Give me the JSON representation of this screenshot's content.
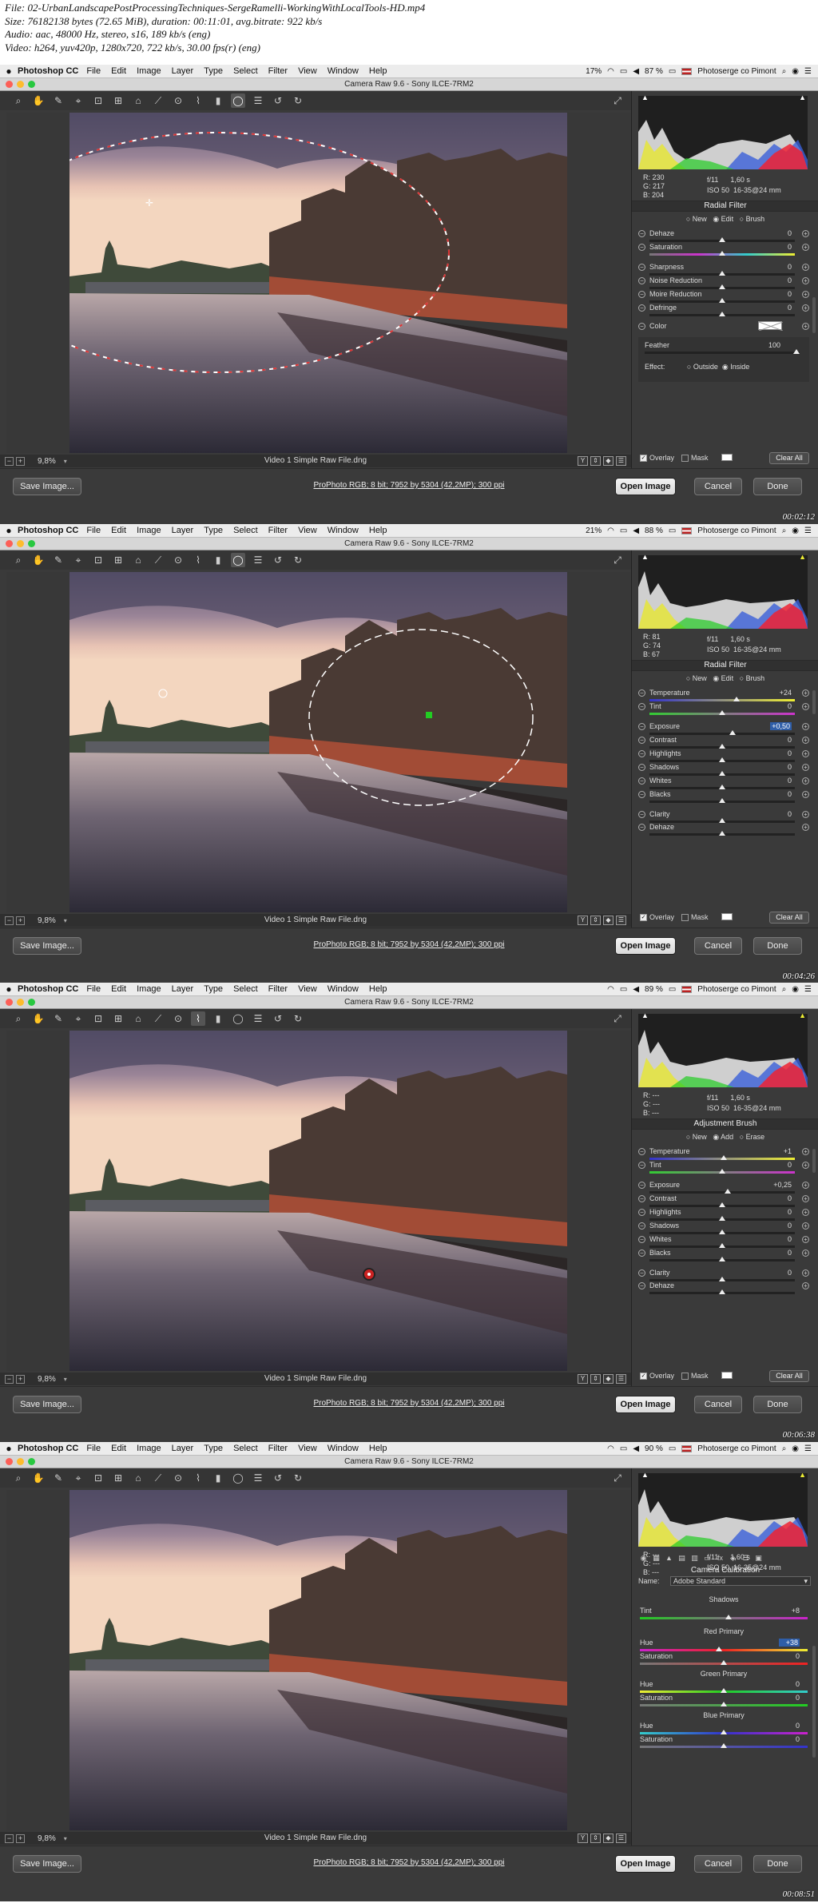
{
  "info_lines": [
    "File: 02-UrbanLandscapePostProcessingTechniques-SergeRamelli-WorkingWithLocalTools-HD.mp4",
    "Size: 76182138 bytes (72.65 MiB), duration: 00:11:01, avg.bitrate: 922 kb/s",
    "Audio: aac, 48000 Hz, stereo, s16, 189 kb/s (eng)",
    "Video: h264, yuv420p, 1280x720, 722 kb/s, 30.00 fps(r) (eng)"
  ],
  "menubar": {
    "app": "Photoshop CC",
    "items": [
      "File",
      "Edit",
      "Image",
      "Layer",
      "Type",
      "Select",
      "Filter",
      "View",
      "Window",
      "Help"
    ],
    "user": "Photoserge co Pimont"
  },
  "window_title": "Camera Raw 9.6  -  Sony ILCE-7RM2",
  "statusbar": {
    "zoom": "9,8%",
    "filename": "Video 1 Simple Raw File.dng"
  },
  "bottom": {
    "save": "Save Image...",
    "workflow": "ProPhoto RGB; 8 bit; 7952 by 5304 (42,2MP); 300 ppi",
    "open": "Open Image",
    "cancel": "Cancel",
    "done": "Done"
  },
  "camera_info": {
    "aperture": "f/11",
    "shutter": "1,60 s",
    "iso": "ISO 50",
    "lens": "16-35@24 mm"
  },
  "overlay": {
    "overlay": "Overlay",
    "mask": "Mask",
    "clear_all": "Clear All"
  },
  "frames": [
    {
      "menu_pct": "17%",
      "battery": "87 %",
      "timestamp": "00:02:12",
      "rgb": {
        "r": "230",
        "g": "217",
        "b": "204"
      },
      "panel_title": "Radial Filter",
      "modes": [
        "New",
        "Edit",
        "Brush"
      ],
      "sliders": [
        {
          "label": "Dehaze",
          "value": "0"
        },
        {
          "label": "Saturation",
          "value": "0"
        },
        {
          "label": "Sharpness",
          "value": "0"
        },
        {
          "label": "Noise Reduction",
          "value": "0"
        },
        {
          "label": "Moire Reduction",
          "value": "0"
        },
        {
          "label": "Defringe",
          "value": "0"
        }
      ],
      "color_label": "Color",
      "feather_label": "Feather",
      "feather_value": "100",
      "effect_label": "Effect:",
      "effect_outside": "Outside",
      "effect_inside": "Inside"
    },
    {
      "menu_pct": "21%",
      "battery": "88 %",
      "timestamp": "00:04:26",
      "rgb": {
        "r": "81",
        "g": "74",
        "b": "67"
      },
      "panel_title": "Radial Filter",
      "modes": [
        "New",
        "Edit",
        "Brush"
      ],
      "sliders": [
        {
          "label": "Temperature",
          "value": "+24"
        },
        {
          "label": "Tint",
          "value": "0"
        },
        {
          "label": "Exposure",
          "value": "+0,50"
        },
        {
          "label": "Contrast",
          "value": "0"
        },
        {
          "label": "Highlights",
          "value": "0"
        },
        {
          "label": "Shadows",
          "value": "0"
        },
        {
          "label": "Whites",
          "value": "0"
        },
        {
          "label": "Blacks",
          "value": "0"
        },
        {
          "label": "Clarity",
          "value": "0"
        },
        {
          "label": "Dehaze",
          "value": ""
        }
      ]
    },
    {
      "menu_pct": "",
      "battery": "89 %",
      "timestamp": "00:06:38",
      "rgb": {
        "r": "---",
        "g": "---",
        "b": "---"
      },
      "panel_title": "Adjustment Brush",
      "modes": [
        "New",
        "Add",
        "Erase"
      ],
      "sliders": [
        {
          "label": "Temperature",
          "value": "+1"
        },
        {
          "label": "Tint",
          "value": "0"
        },
        {
          "label": "Exposure",
          "value": "+0,25"
        },
        {
          "label": "Contrast",
          "value": "0"
        },
        {
          "label": "Highlights",
          "value": "0"
        },
        {
          "label": "Shadows",
          "value": "0"
        },
        {
          "label": "Whites",
          "value": "0"
        },
        {
          "label": "Blacks",
          "value": "0"
        },
        {
          "label": "Clarity",
          "value": "0"
        },
        {
          "label": "Dehaze",
          "value": ""
        }
      ]
    },
    {
      "menu_pct": "",
      "battery": "90 %",
      "timestamp": "00:08:51",
      "rgb": {
        "r": "---",
        "g": "---",
        "b": "---"
      },
      "panel_title": "Camera Calibration",
      "name_label": "Name:",
      "name_value": "Adobe Standard",
      "shadows_label": "Shadows",
      "tint_label": "Tint",
      "tint_value": "+8",
      "red_label": "Red Primary",
      "red_hue_label": "Hue",
      "red_hue_value": "+38",
      "red_sat_label": "Saturation",
      "red_sat_value": "0",
      "green_label": "Green Primary",
      "green_hue_label": "Hue",
      "green_hue_value": "0",
      "green_sat_label": "Saturation",
      "green_sat_value": "0",
      "blue_label": "Blue Primary",
      "blue_hue_label": "Hue",
      "blue_hue_value": "0",
      "blue_sat_label": "Saturation",
      "blue_sat_value": "0"
    }
  ]
}
